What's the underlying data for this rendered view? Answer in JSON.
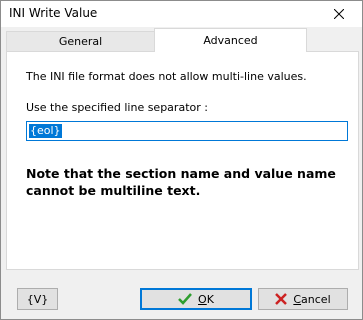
{
  "window": {
    "title": "INI Write Value"
  },
  "tabs": [
    {
      "label": "General",
      "selected": false
    },
    {
      "label": "Advanced",
      "selected": true
    }
  ],
  "panel": {
    "info_text": "The INI file format does not allow multi-line values.",
    "separator_label": "Use the specified line separator :",
    "separator_value": "{eol}",
    "note_text": "Note that the section name and value name cannot be multiline text."
  },
  "buttons": {
    "variables_label": "{V}",
    "ok_accel": "O",
    "ok_rest": "K",
    "cancel_accel": "C",
    "cancel_rest": "ancel"
  },
  "colors": {
    "accent": "#0078d7",
    "ok_check": "#2e9e2e",
    "cancel_x": "#cc2222"
  }
}
